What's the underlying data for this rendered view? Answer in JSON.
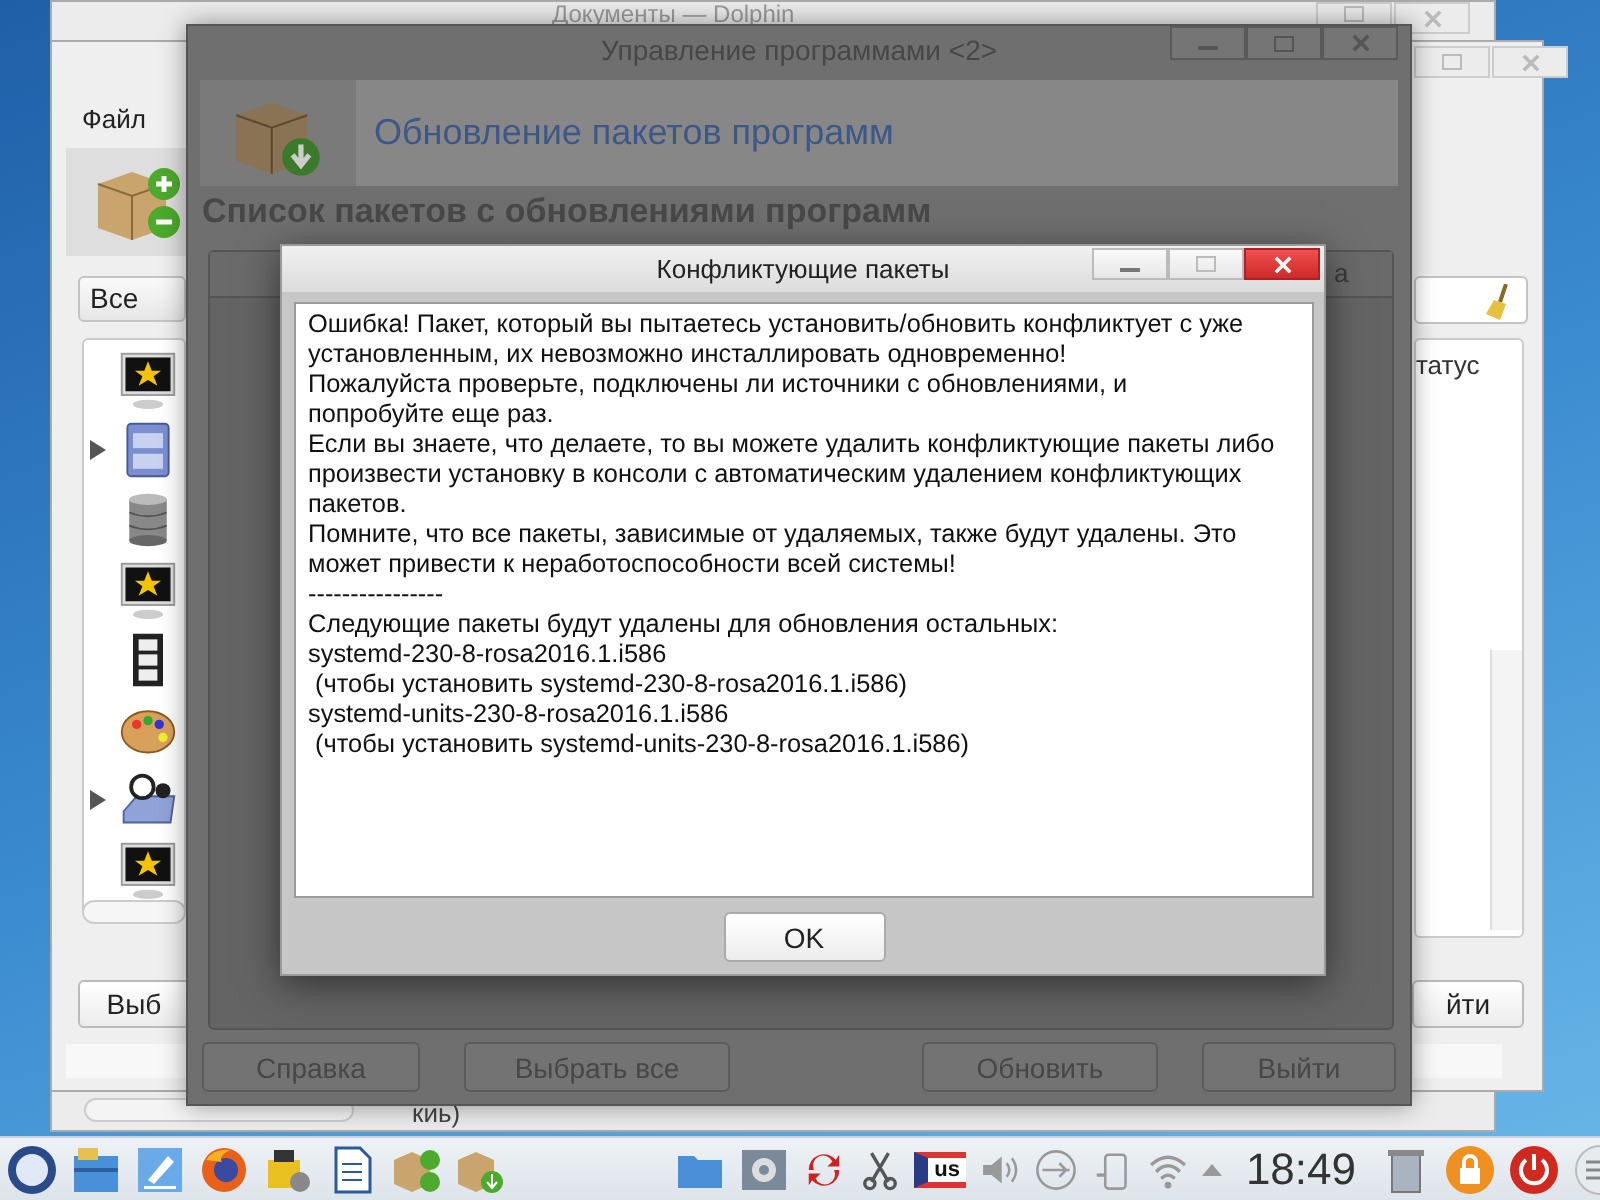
{
  "dolphin_window": {
    "title": "Документы — Dolphin",
    "status_fragment": "киь)"
  },
  "installer_window": {
    "menu": [
      "Файл"
    ],
    "filter": "Все",
    "status_column": "татус",
    "tree_items": [
      {
        "has_children": false
      },
      {
        "has_children": true
      },
      {
        "has_children": false
      },
      {
        "has_children": false
      },
      {
        "has_children": false
      },
      {
        "has_children": false
      },
      {
        "has_children": true
      },
      {
        "has_children": false
      }
    ],
    "buttons": [
      "Выб",
      "йти"
    ]
  },
  "manager_window": {
    "title": "Управление программами <2>",
    "banner": "Обновление пакетов программ",
    "heading": "Список пакетов с обновлениями программ",
    "column_fragment": "а",
    "buttons": [
      "Справка",
      "Выбрать все",
      "Обновить",
      "Выйти"
    ]
  },
  "dialog": {
    "title": "Конфликтующие пакеты",
    "message": [
      "Ошибка! Пакет, который вы пытаетесь установить/обновить конфликтует с уже установленным, их невозможно инсталлировать одновременно!",
      "Пожалуйста проверьте, подключены ли источники с обновлениями, и\nпопробуйте еще раз.",
      "Если вы знаете, что делаете, то вы можете удалить конфликтующие пакеты либо произвести установку в консоли с автоматическим удалением конфликтующих пакетов.",
      "Помните, что все пакеты, зависимые от удаляемых, также будут удалены. Это может привести к неработоспособности всей системы!",
      "----------------",
      "Следующие пакеты будут удалены для обновления остальных:",
      "systemd-230-8-rosa2016.1.i586",
      " (чтобы установить systemd-230-8-rosa2016.1.i586)",
      "systemd-units-230-8-rosa2016.1.i586",
      " (чтобы установить systemd-units-230-8-rosa2016.1.i586)"
    ],
    "buttons": [
      "OK"
    ]
  },
  "taskbar": {
    "keyboard_layout": "us",
    "clock": "18:49"
  }
}
